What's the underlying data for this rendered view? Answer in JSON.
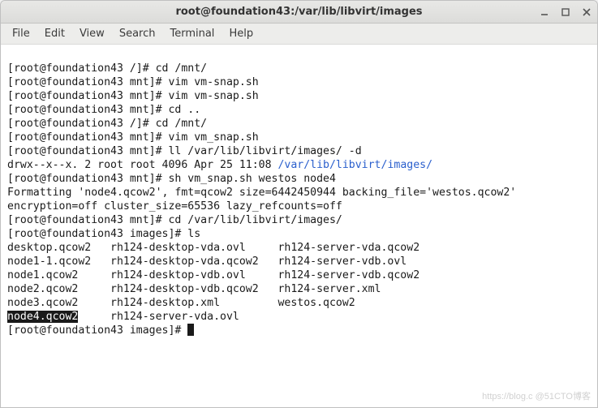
{
  "titlebar": {
    "title": "root@foundation43:/var/lib/libvirt/images"
  },
  "menubar": {
    "file": "File",
    "edit": "Edit",
    "view": "View",
    "search": "Search",
    "terminal": "Terminal",
    "help": "Help"
  },
  "term": {
    "l01": "[root@foundation43 /]# cd /mnt/",
    "l02": "[root@foundation43 mnt]# vim vm-snap.sh",
    "l03": "[root@foundation43 mnt]# vim vm-snap.sh",
    "l04": "[root@foundation43 mnt]# cd ..",
    "l05": "[root@foundation43 /]# cd /mnt/",
    "l06": "[root@foundation43 mnt]# vim vm_snap.sh",
    "l07": "[root@foundation43 mnt]# ll /var/lib/libvirt/images/ -d",
    "l08a": "drwx--x--x. 2 root root 4096 Apr 25 11:08 ",
    "l08b": "/var/lib/libvirt/images/",
    "l09": "[root@foundation43 mnt]# sh vm_snap.sh westos node4",
    "l10": "Formatting 'node4.qcow2', fmt=qcow2 size=6442450944 backing_file='westos.qcow2' ",
    "l11": "encryption=off cluster_size=65536 lazy_refcounts=off",
    "l12": "[root@foundation43 mnt]# cd /var/lib/libvirt/images/",
    "l13": "[root@foundation43 images]# ls",
    "l14": "desktop.qcow2   rh124-desktop-vda.ovl     rh124-server-vda.qcow2",
    "l15": "node1-1.qcow2   rh124-desktop-vda.qcow2   rh124-server-vdb.ovl",
    "l16": "node1.qcow2     rh124-desktop-vdb.ovl     rh124-server-vdb.qcow2",
    "l17": "node2.qcow2     rh124-desktop-vdb.qcow2   rh124-server.xml",
    "l18": "node3.qcow2     rh124-desktop.xml         westos.qcow2",
    "l19a": "node4.qcow2",
    "l19b": "     rh124-server-vda.ovl",
    "l20": "[root@foundation43 images]# "
  },
  "watermark": "https://blog.c @51CTO博客"
}
